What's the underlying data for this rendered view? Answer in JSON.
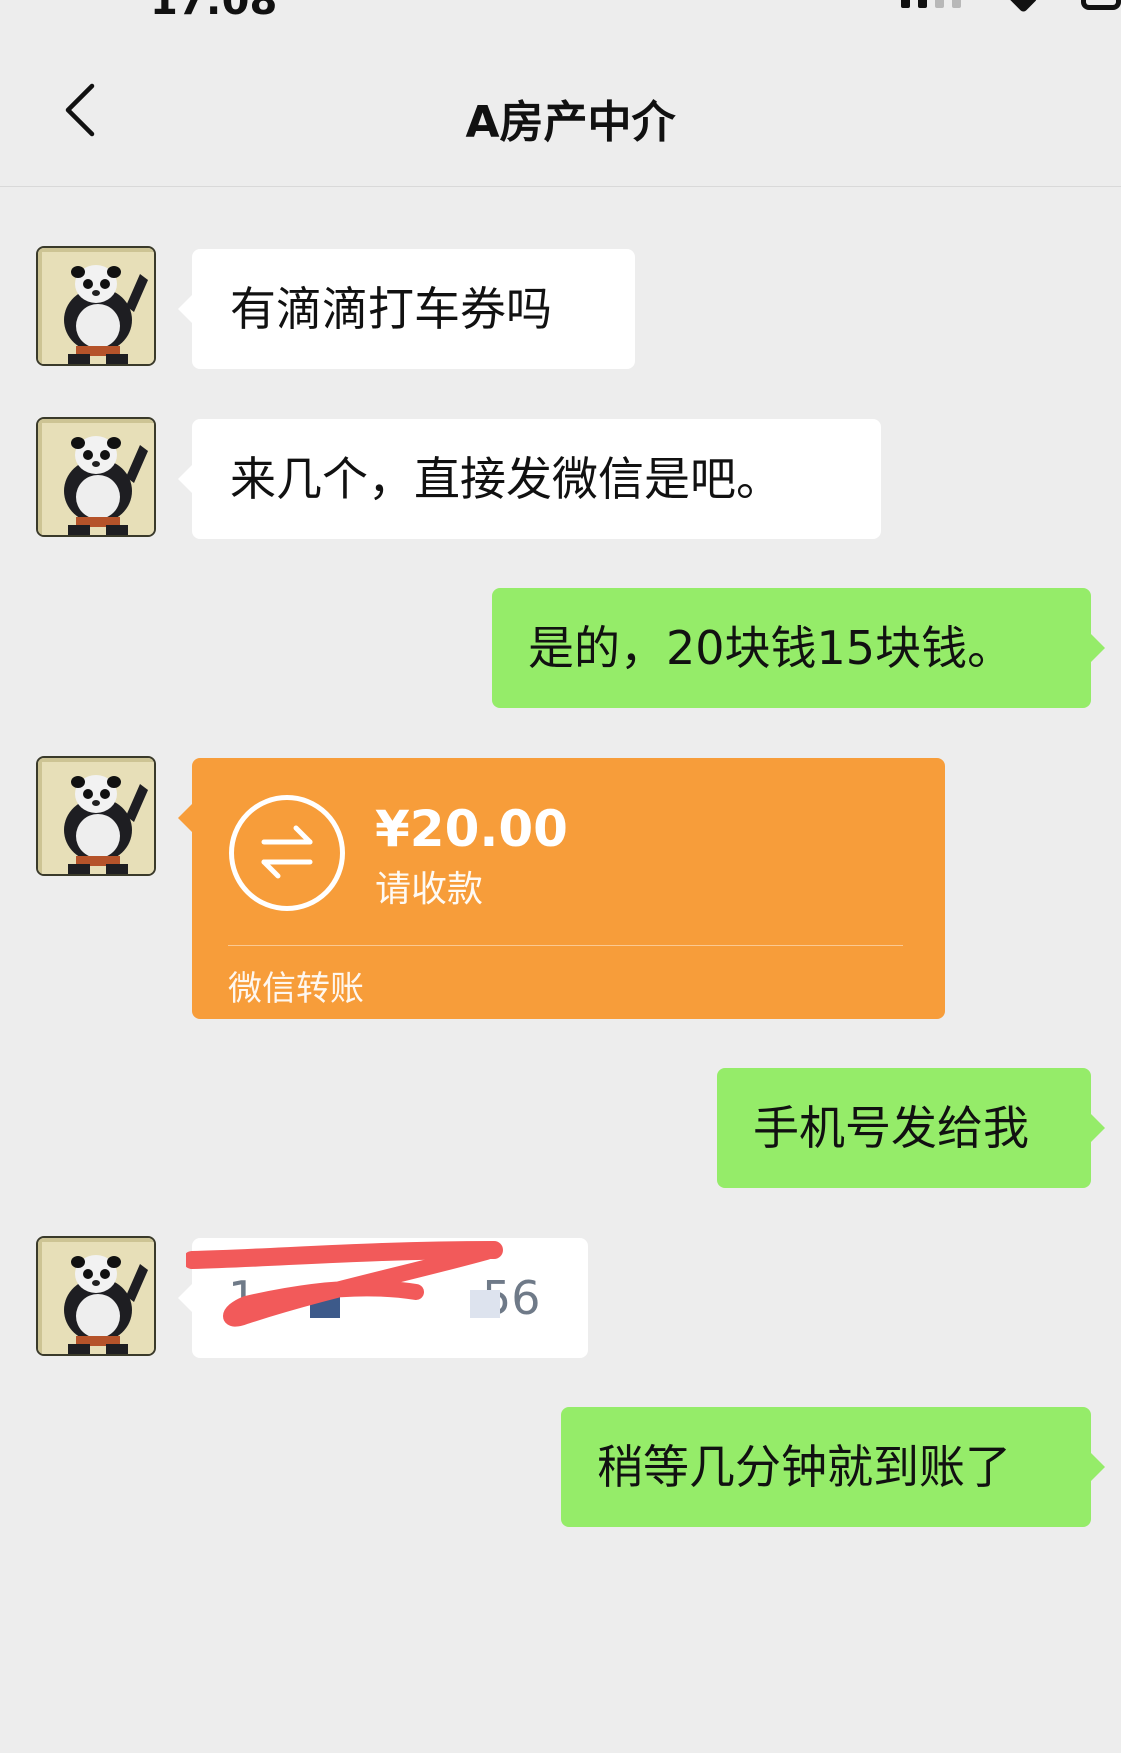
{
  "status_bar": {
    "time": "17:08"
  },
  "nav": {
    "title": "A房产中介",
    "back_icon": "chevron-left-icon"
  },
  "messages": [
    {
      "side": "left",
      "text": "有滴滴打车券吗"
    },
    {
      "side": "left",
      "text": "来几个，直接发微信是吧。"
    },
    {
      "side": "right",
      "text": "是的，20块钱15块钱。"
    },
    {
      "side": "left",
      "type": "transfer",
      "amount": "¥20.00",
      "status": "请收款",
      "footer": "微信转账",
      "icon": "transfer-arrows-icon"
    },
    {
      "side": "right",
      "text": "手机号发给我"
    },
    {
      "side": "left",
      "type": "redacted",
      "visible_start": "1",
      "visible_end": "56"
    },
    {
      "side": "right",
      "text": "稍等几分钟就到账了"
    }
  ],
  "colors": {
    "background": "#ededed",
    "self_bubble": "#95ec69",
    "other_bubble": "#ffffff",
    "transfer_card": "#f79d3a",
    "redaction": "#f25a5a"
  }
}
